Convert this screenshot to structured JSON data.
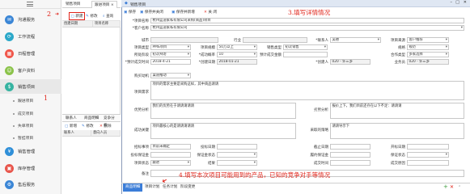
{
  "colors": {
    "accent": "#3b7dd8",
    "annotation": "#e0241a"
  },
  "sidebar": {
    "items": [
      {
        "label": "沟通服务",
        "icon": "chat-icon",
        "color": "#3b86d6"
      },
      {
        "label": "工作流程",
        "icon": "workflow-icon",
        "color": "#2ba8c9"
      },
      {
        "label": "日程管理",
        "icon": "calendar-icon",
        "color": "#f0574b"
      },
      {
        "label": "客户资料",
        "icon": "customer-icon",
        "color": "#8bc34a"
      },
      {
        "label": "销售项目",
        "icon": "sales-icon",
        "color": "#36b3a1"
      },
      {
        "label": "销售管理",
        "icon": "sales-manage-icon",
        "color": "#2f8fd8"
      },
      {
        "label": "库存管理",
        "icon": "inventory-icon",
        "color": "#e8554b"
      },
      {
        "label": "售后服务",
        "icon": "service-icon",
        "color": "#3b86d6"
      }
    ],
    "subitems": [
      "跟进项目",
      "成交项目",
      "失单项目",
      "暂挂项目"
    ]
  },
  "list": {
    "tabs": [
      "销售项目",
      "跟进项目 ×"
    ],
    "toolbar": [
      "新建",
      "修改",
      "查询"
    ],
    "columns": [
      "创建日期",
      "项目名称"
    ],
    "bottom_tabs": [
      "联系人",
      "商品明细",
      "竞争分析"
    ],
    "bottom_toolbar": [
      "新增",
      "修改",
      "删除"
    ],
    "bottom_columns": [
      "联系人",
      "意向人员"
    ]
  },
  "dialog": {
    "title": "销售项目",
    "toolbar": {
      "save": "保存",
      "save_close": "保存并关闭",
      "save_new": "保存并新增",
      "close": "关 闭"
    },
    "labels": {
      "project_name": "*项目名称",
      "customer": "*客户名称",
      "city": "城市",
      "industry": "行业",
      "contact": "*联系人",
      "project_source": "项目来源",
      "project_type": "项目类型",
      "project_scale": "项目规模",
      "sales_type": "销售类型",
      "spec": "规格",
      "stage": "所处阶段",
      "win_rate": "*成功概率",
      "est_amount": "预计成交金额",
      "contract_type": "合作类型",
      "est_date": "*预计成交时间",
      "created": "*创建日期",
      "creator": "*创建人",
      "sales_person": "业务员",
      "buy_purpose": "购买动机",
      "needs": "项目需求",
      "advantage": "优势分析",
      "disadvantage": "劣势分析",
      "success_key": "成功关键",
      "decision_process": "采取的策略",
      "tender_date": "招标事项",
      "bid_date": "投标日期",
      "deadline": "截止日期",
      "open_date": "开标日期",
      "bid_bond": "投标保证金",
      "bond_status": "保证金状态",
      "perf_bond": "履约保证金",
      "perf_status": "保证状态",
      "bid_status": "项目状态",
      "result": "结果",
      "close_time": "成交时间",
      "close_reason": "成交原因",
      "remark": "备注"
    },
    "values": {
      "project_name": "杭州蓝迪家私有限公司采购(商品)项目",
      "customer": "杭州蓝迪家私有限公司",
      "contact": "吴德",
      "project_source": "客户推荐",
      "project_type": "PMS项目",
      "project_scale": "50万以上",
      "sales_type": "初次销售",
      "spec": "规范",
      "stage": "初次拜访",
      "win_rate": "10",
      "contract_type": "多家选择",
      "est_date": "2018-4-21",
      "created": "2018-01-21",
      "creator": "020 - 许三多",
      "sales_person": "020 - 许三多",
      "buy_purpose": "渠道推动",
      "needs": "项目的需求主要是采购这样，其中商品请请",
      "advantage": "我们的优势在于请请请请请",
      "disadvantage": "报价上下，我们目前还存在以下不足：请请请",
      "success_key": "项目最核心的是请请请请请",
      "decision_process": "请请导示下",
      "tender_date": "目前未确定",
      "bid_status": "跟进"
    },
    "tabs": [
      "商品明细",
      "项目计划",
      "任务计划",
      "阶段变更"
    ]
  },
  "annotations": {
    "a1": "1",
    "a2": "2",
    "a3": "3.填写详情情况",
    "a4": "4.填写本次项目可能用到的产品，已知的竞争对手等情况"
  }
}
